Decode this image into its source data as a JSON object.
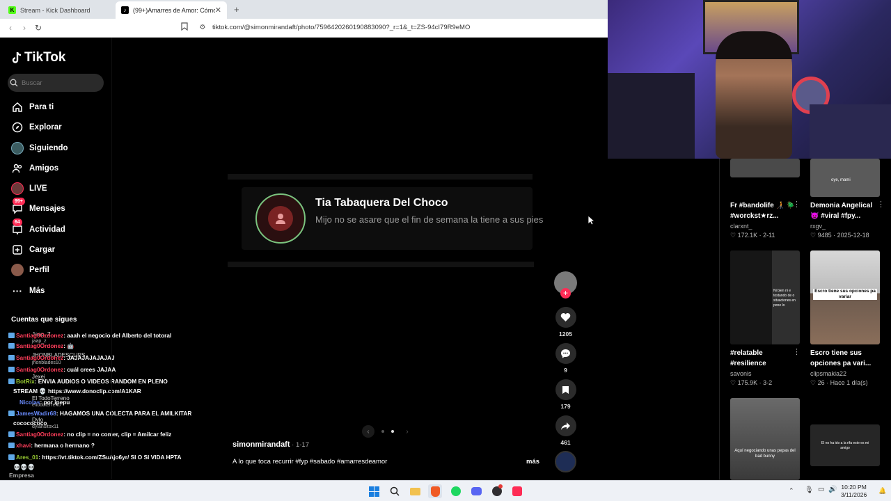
{
  "browser": {
    "tabs": [
      {
        "label": "Stream - Kick Dashboard",
        "favicon": "K"
      },
      {
        "label": "(99+)Amarres de Amor: Cómo Fu",
        "favicon": "♪"
      }
    ],
    "url": "tiktok.com/@simonmirandaft/photo/7596420260190883090?_r=1&_t=ZS-94cI79R9eMO"
  },
  "sidebar": {
    "logo": "TikTok",
    "search_placeholder": "Buscar",
    "nav": [
      {
        "label": "Para ti",
        "icon": "home-icon"
      },
      {
        "label": "Explorar",
        "icon": "compass-icon"
      },
      {
        "label": "Siguiendo",
        "icon": "following-avatar-icon"
      },
      {
        "label": "Amigos",
        "icon": "friends-icon"
      },
      {
        "label": "LIVE",
        "icon": "live-icon"
      },
      {
        "label": "Mensajes",
        "icon": "messages-icon",
        "badge": "99+"
      },
      {
        "label": "Actividad",
        "icon": "activity-icon",
        "badge": "64"
      },
      {
        "label": "Cargar",
        "icon": "upload-icon"
      },
      {
        "label": "Perfil",
        "icon": "profile-icon"
      },
      {
        "label": "Más",
        "icon": "more-icon"
      }
    ],
    "following_title": "Cuentas que sigues",
    "following_ghosts": [
      "Jaap_Z",
      "jaap_z",
      "JHONBLADESCLIPS",
      "jhonblades10",
      "Jexei",
      "El TodoTerreno",
      "eltodoterreno",
      "Dylo",
      "dylansitox11"
    ],
    "footer": "Empresa"
  },
  "chat": [
    {
      "name": "Santiag0Ordonez",
      "msg": ": aaah el negocio del Alberto del totoral",
      "color": "red"
    },
    {
      "name": "Santiag0Ordonez",
      "msg": ": 🤖",
      "color": "red"
    },
    {
      "name": "Santiag0Ordonez",
      "msg": ": JAJAJAJAJAJAJ",
      "color": "red"
    },
    {
      "name": "Santiag0Ordonez",
      "msg": ": cuál crees JAJAA",
      "color": "red"
    },
    {
      "name": "BotRix",
      "msg": ": ENVIA AUDIOS O VIDEOS RANDOM EN PLENO",
      "color": "green"
    },
    {
      "name": "",
      "msg": "STREAM 💀 https://www.donoclip.com/A1KAR",
      "color": "none"
    },
    {
      "name": "Nicolas",
      "msg": ": por ipepu",
      "color": "red"
    },
    {
      "name": "JamesWadir68",
      "msg": ": HAGAMOS UNA COLECTA PARA EL AMILKITAR",
      "color": "blue"
    },
    {
      "name": "cococococo",
      "msg": "",
      "color": "none"
    },
    {
      "name": "Santiag0Ordonez",
      "msg": ": no clip = no comer, clip = Amilcar feliz",
      "color": "red"
    },
    {
      "name": "xhavi",
      "msg": ": hermana o hermano ?",
      "color": "red"
    },
    {
      "name": "Ares_01",
      "msg": ": https://vt.tiktok.com/ZSuAjo6yr/ SI O SI VIDA HPTA",
      "color": "green"
    },
    {
      "name": "",
      "msg": "💀💀💀",
      "color": "none"
    }
  ],
  "post": {
    "notification_name": "Tia Tabaquera Del Choco",
    "notification_message": "Mijo no se asare que el fin de semana la tiene a sus pies",
    "author": "simonmirandaft",
    "date": " · 1-17",
    "caption": "A lo que toca recurrir #fyp #sabado #amarresdeamor",
    "more": "más",
    "likes": "1205",
    "comments": "9",
    "saves": "179",
    "shares": "461"
  },
  "grid": [
    {
      "title": "Fr #bandolife 🧑‍🦯 🪲 #worckst★rz...",
      "user": "clarxnt_",
      "stats": "♡ 172.1K · 2-11",
      "thumb_text": ""
    },
    {
      "title": "Demonia Angelical 👿 #viral #fpy...",
      "user": "rxgv_",
      "stats": "♡ 9485 · 2025-12-18",
      "thumb_text": "oye, mami"
    },
    {
      "title": "#relatable #resilience",
      "user": "savonis",
      "stats": "♡ 175.9K · 3-2",
      "thumb_text": "Ni bien ni e tostando de o situaciones en pone lo"
    },
    {
      "title": "Escro tiene sus opciones pa vari...",
      "user": "clipsmakia22",
      "stats": "♡ 26 · Hace 1 día(s)",
      "thumb_text": "Escro tiene sus opciones pa variar"
    },
    {
      "title": "",
      "user": "",
      "stats": "",
      "thumb_text": "Aquí negociando unas pepas del bad bunny"
    },
    {
      "title": "",
      "user": "",
      "stats": "",
      "thumb_text": "El no ha ido a la rifa este es mi amigo"
    }
  ],
  "taskbar": {
    "time": "10:20 PM",
    "date": "3/11/2026"
  },
  "colors": {
    "tiktok_red": "#fe2c55",
    "notif_ring": "#7bc47f"
  }
}
